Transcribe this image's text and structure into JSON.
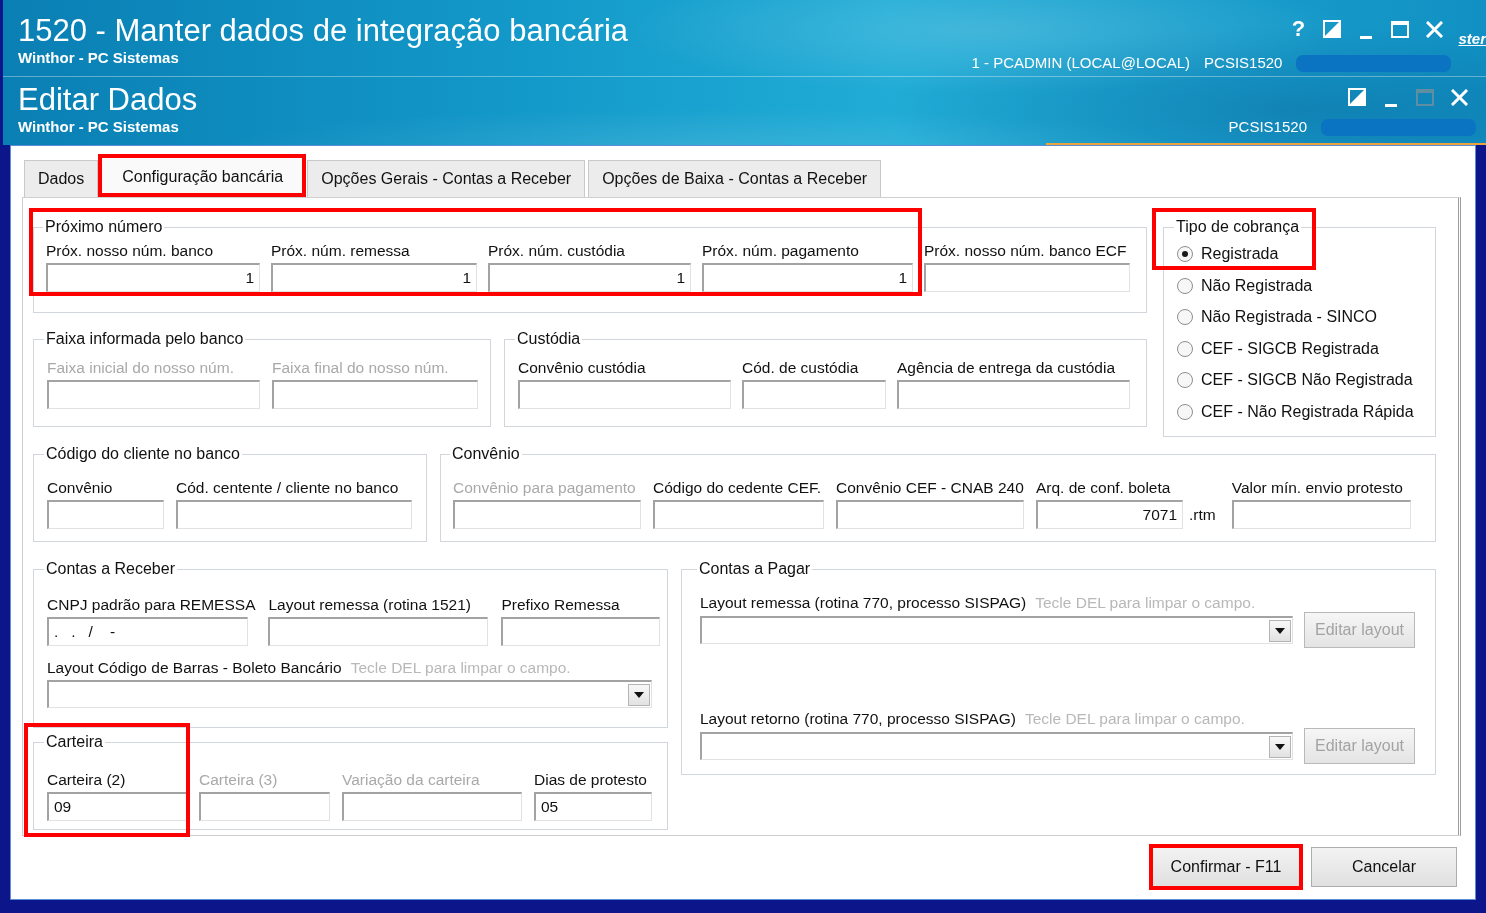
{
  "windows": [
    {
      "title": "1520 - Manter dados de integração bancária",
      "subtitle": "Winthor - PC Sistemas",
      "controls": [
        {
          "kind": "help",
          "symbol": "?",
          "disabled": false
        },
        {
          "kind": "dock",
          "disabled": false
        },
        {
          "kind": "minimize",
          "disabled": false
        },
        {
          "kind": "maximize",
          "disabled": false
        },
        {
          "kind": "close",
          "disabled": false
        }
      ],
      "user": "1 - PCADMIN (LOCAL@LOCAL)",
      "program": "PCSIS1520",
      "edge_link": "ster"
    },
    {
      "title": "Editar Dados",
      "subtitle": "Winthor - PC Sistemas",
      "controls": [
        {
          "kind": "dock",
          "disabled": false
        },
        {
          "kind": "minimize",
          "disabled": false
        },
        {
          "kind": "maximize",
          "disabled": true
        },
        {
          "kind": "close",
          "disabled": false
        }
      ],
      "program": "PCSIS1520"
    }
  ],
  "tabs": [
    {
      "label": "Dados",
      "selected": false,
      "highlighted": false
    },
    {
      "label": "Configuração bancária",
      "selected": true,
      "highlighted": true
    },
    {
      "label": "Opções Gerais - Contas a Receber",
      "selected": false,
      "highlighted": false
    },
    {
      "label": "Opções de Baixa - Contas a Receber",
      "selected": false,
      "highlighted": false
    }
  ],
  "next_number": {
    "legend": "Próximo número",
    "fields": [
      {
        "label": "Próx. nosso núm. banco",
        "value": "1",
        "kind": "number",
        "disabled": false,
        "highlighted": true
      },
      {
        "label": "Próx. núm. remessa",
        "value": "1",
        "kind": "number",
        "disabled": false,
        "highlighted": true
      },
      {
        "label": "Próx. núm. custódia",
        "value": "1",
        "kind": "number",
        "disabled": false,
        "highlighted": true
      },
      {
        "label": "Próx. núm. pagamento",
        "value": "1",
        "kind": "number",
        "disabled": false,
        "highlighted": true
      },
      {
        "label": "Próx. nosso núm. banco ECF",
        "disabled": false,
        "highlighted": false
      }
    ]
  },
  "billing_type": {
    "legend": "Tipo de cobrança",
    "options": [
      {
        "label": "Registrada",
        "selected": true,
        "highlighted": true
      },
      {
        "label": "Não Registrada",
        "selected": false,
        "highlighted": false
      },
      {
        "label": "Não Registrada - SINCO",
        "selected": false,
        "highlighted": false
      },
      {
        "label": "CEF - SIGCB Registrada",
        "selected": false,
        "highlighted": false
      },
      {
        "label": "CEF - SIGCB Não Registrada",
        "selected": false,
        "highlighted": false
      },
      {
        "label": "CEF - Não Registrada Rápida",
        "selected": false,
        "highlighted": false
      }
    ]
  },
  "bank_range": {
    "legend": "Faixa informada pelo banco",
    "fields": [
      {
        "label": "Faixa inicial do nosso núm.",
        "disabled": true
      },
      {
        "label": "Faixa final do nosso núm.",
        "disabled": true
      }
    ]
  },
  "custody": {
    "legend": "Custódia",
    "fields": [
      {
        "label": "Convênio custódia",
        "disabled": false
      },
      {
        "label": "Cód. de custódia",
        "disabled": false
      },
      {
        "label": "Agência de entrega da custódia",
        "disabled": false
      }
    ]
  },
  "client_code": {
    "legend": "Código do cliente no banco",
    "fields": [
      {
        "label": "Convênio",
        "disabled": false
      },
      {
        "label": "Cód. centente / cliente no banco",
        "disabled": false
      }
    ]
  },
  "agreement": {
    "legend": "Convênio",
    "fields": [
      {
        "label": "Convênio para pagamento",
        "disabled": true
      },
      {
        "label": "Código do cedente CEF.",
        "disabled": false
      },
      {
        "label": "Convênio CEF - CNAB 240",
        "disabled": false
      },
      {
        "label": "Arq. de conf. boleta",
        "value": "7071",
        "kind": "number",
        "suffix": ".rtm",
        "disabled": false
      },
      {
        "label": "Valor mín. envio protesto",
        "disabled": false
      }
    ]
  },
  "receivables": {
    "legend": "Contas a Receber",
    "fields": [
      {
        "label": "CNPJ padrão para REMESSA",
        "value": ".   .   /    -",
        "disabled": false
      },
      {
        "label": "Layout remessa (rotina 1521)",
        "disabled": false
      },
      {
        "label": "Prefixo Remessa",
        "disabled": false
      }
    ],
    "layout": {
      "label": "Layout Código de Barras - Boleto Bancário",
      "hint": "Tecle DEL para limpar o campo."
    }
  },
  "wallet": {
    "legend": "Carteira",
    "fields": [
      {
        "label": "Carteira (2)",
        "value": "09",
        "disabled": false,
        "highlighted": true
      },
      {
        "label": "Carteira (3)",
        "disabled": true,
        "highlighted": false
      },
      {
        "label": "Variação da carteira",
        "disabled": true,
        "highlighted": false
      },
      {
        "label": "Dias de protesto",
        "value": "05",
        "disabled": false,
        "highlighted": false
      }
    ]
  },
  "payables": {
    "legend": "Contas a Pagar",
    "layouts": [
      {
        "label": "Layout remessa (rotina 770, processo SISPAG)",
        "hint": "Tecle DEL para limpar o campo.",
        "button": "Editar layout",
        "button_disabled": true
      },
      {
        "label": "Layout retorno (rotina 770, processo SISPAG)",
        "hint": "Tecle DEL para limpar o campo.",
        "button": "Editar layout",
        "button_disabled": true
      }
    ]
  },
  "buttons": [
    {
      "label": "Confirmar - F11",
      "highlighted": true
    },
    {
      "label": "Cancelar",
      "highlighted": false
    }
  ]
}
